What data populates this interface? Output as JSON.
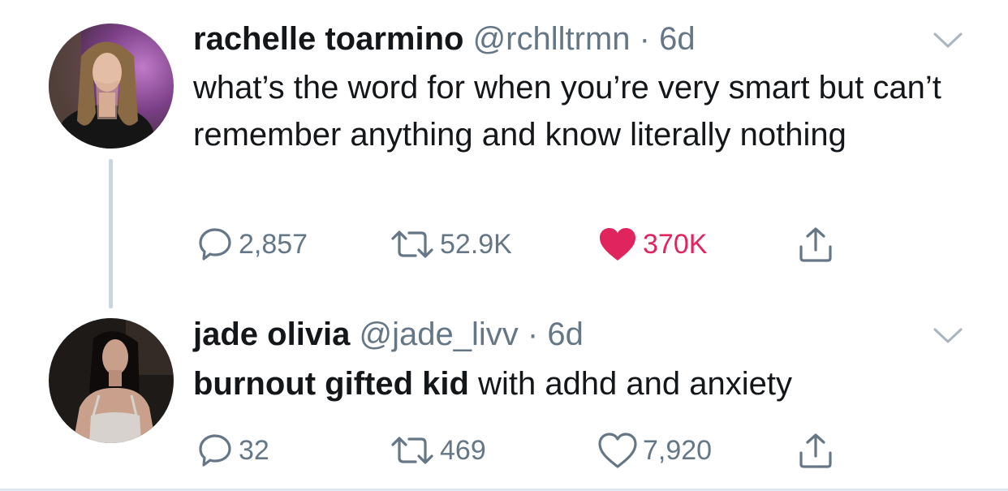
{
  "tweets": [
    {
      "display_name": "rachelle toarmino",
      "handle": "@rchlltrmn",
      "separator": "·",
      "time": "6d",
      "text": "what’s the word for when you’re very smart but can’t remember anything and know literally nothing",
      "replies": "2,857",
      "retweets": "52.9K",
      "likes": "370K",
      "liked": true,
      "has_thread_line": true
    },
    {
      "display_name": "jade olivia",
      "handle": "@jade_livv",
      "separator": "·",
      "time": "6d",
      "text_bold": "burnout gifted kid",
      "text_rest": " with adhd and anxiety",
      "replies": "32",
      "retweets": "469",
      "likes": "7,920",
      "liked": false,
      "has_thread_line": false
    }
  ],
  "icons": {
    "reply": "speech-bubble-icon",
    "retweet": "retweet-arrows-icon",
    "like": "heart-icon",
    "share": "share-upload-icon",
    "menu": "chevron-down-icon"
  },
  "colors": {
    "text_primary": "#14171a",
    "text_secondary": "#657786",
    "like_active": "#e0245e",
    "thread_line": "#ccd6dd"
  }
}
